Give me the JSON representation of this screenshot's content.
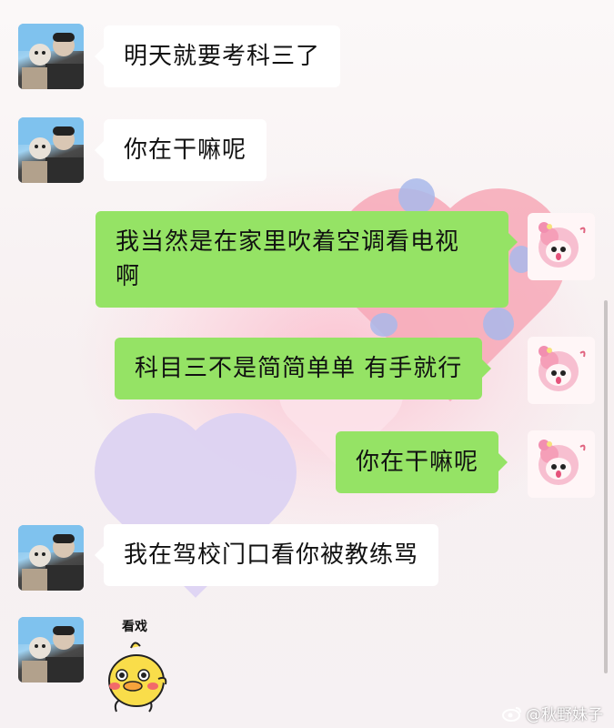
{
  "messages": [
    {
      "side": "in",
      "text": "明天就要考科三了"
    },
    {
      "side": "in",
      "text": "你在干嘛呢"
    },
    {
      "side": "out",
      "text_line1": "我当然是在家里吹着空调看电视",
      "text_line2": "啊"
    },
    {
      "side": "out",
      "text": "科目三不是简简单单 有手就行"
    },
    {
      "side": "out",
      "text": "你在干嘛呢"
    },
    {
      "side": "in",
      "text": "我在驾校门口看你被教练骂"
    },
    {
      "side": "in",
      "sticker": "yellow-duck-sticker",
      "sticker_label": "看戏"
    }
  ],
  "watermark": {
    "text": "@秋野妹子",
    "icon": "weibo-logo-icon"
  },
  "colors": {
    "incoming_bubble": "#ffffff",
    "outgoing_bubble": "#95e365"
  }
}
